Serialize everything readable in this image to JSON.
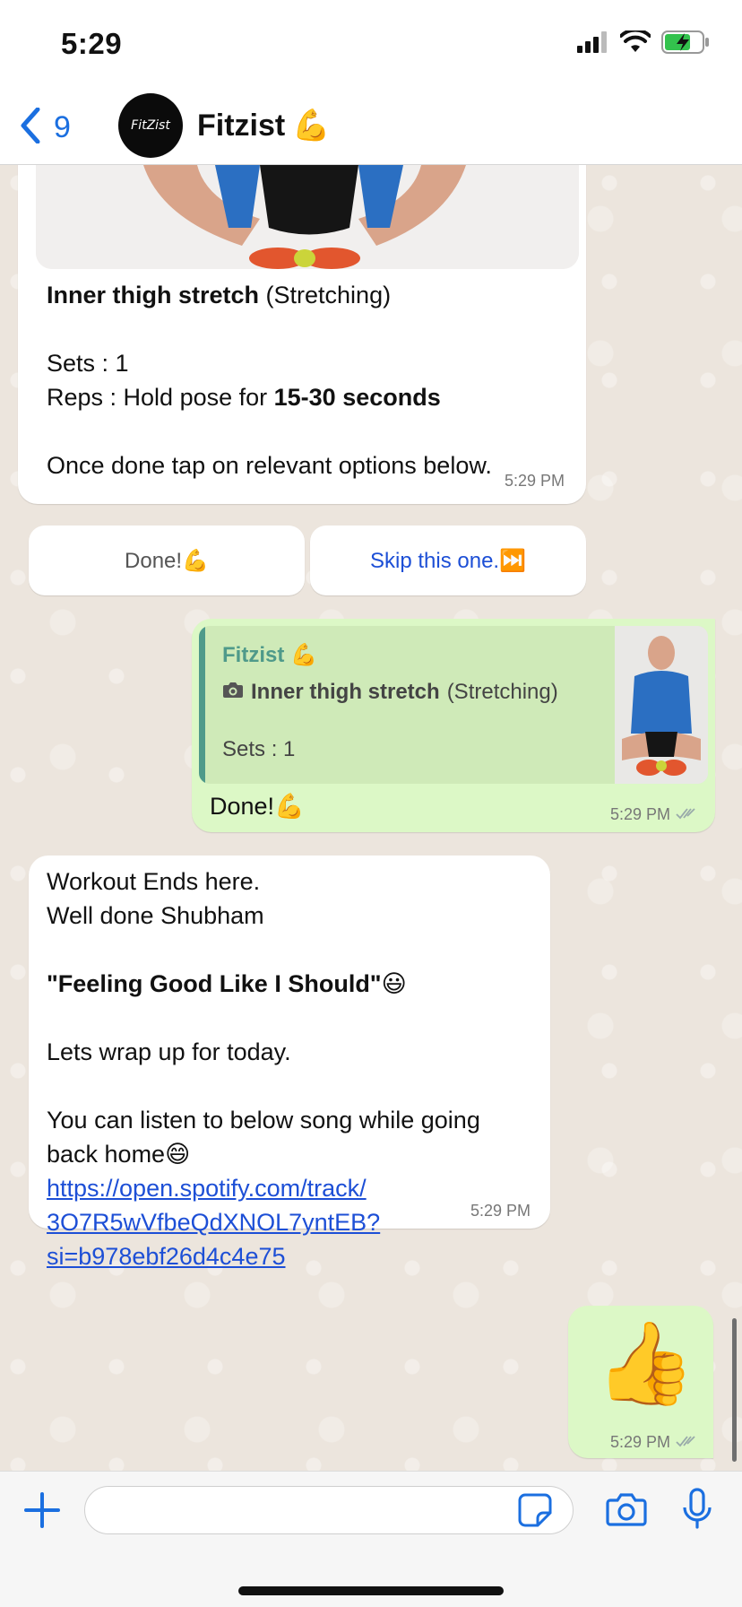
{
  "status": {
    "time": "5:29"
  },
  "header": {
    "back_count": "9",
    "contact_name": "Fitzist",
    "avatar_text": "FitZist",
    "name_emoji": "💪"
  },
  "messages": {
    "exercise": {
      "title": "Inner thigh stretch",
      "category": "(Stretching)",
      "sets": "Sets : 1",
      "reps_prefix": "Reps : Hold pose for ",
      "reps_value": "15-30 seconds",
      "instruction": "Once done tap on relevant options below.",
      "time": "5:29 PM"
    },
    "quick_replies": {
      "done": "Done!💪",
      "skip": "Skip this one.⏭️"
    },
    "reply": {
      "quote_name": "Fitzist 💪",
      "quote_title": "Inner thigh stretch",
      "quote_category": "(Stretching)",
      "quote_sets": "Sets : 1",
      "text": "Done!💪",
      "time": "5:29 PM"
    },
    "wrapup": {
      "line1": "Workout Ends here.",
      "line2": "Well done Shubham",
      "quote": "\"Feeling Good Like I Should\"",
      "quote_emoji": "😃",
      "line3": "Lets wrap up for today.",
      "line4": "You can listen to below song while going",
      "line5": "back home😄",
      "link1": "https://open.spotify.com/track/",
      "link2": "3O7R5wVfbeQdXNOL7yntEB?",
      "link3": "si=b978ebf26d4c4e75",
      "time": "5:29 PM"
    },
    "thumbs": {
      "emoji": "👍",
      "time": "5:29 PM"
    }
  },
  "input": {
    "placeholder": ""
  },
  "colors": {
    "accent": "#1b6fe0",
    "outgoing": "#dcf8c6",
    "incoming": "#ffffff",
    "chat_bg": "#ece5dd"
  }
}
